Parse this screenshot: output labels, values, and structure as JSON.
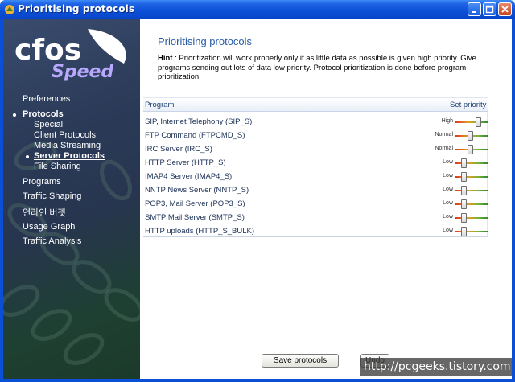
{
  "window": {
    "title": "Prioritising protocols"
  },
  "sidebar": {
    "logo_text": "cfos",
    "logo_subtext": "Speed",
    "items": [
      {
        "label": "Preferences",
        "level": 0,
        "bullet": false,
        "bold": false
      },
      {
        "label": "Protocols",
        "level": 0,
        "bullet": true,
        "bold": true
      },
      {
        "label": "Special",
        "level": 1,
        "bullet": false,
        "bold": false
      },
      {
        "label": "Client Protocols",
        "level": 1,
        "bullet": false,
        "bold": false
      },
      {
        "label": "Media Streaming",
        "level": 1,
        "bullet": false,
        "bold": false
      },
      {
        "label": "Server Protocols",
        "level": 1,
        "bullet": true,
        "bold": true,
        "active": true
      },
      {
        "label": "File Sharing",
        "level": 1,
        "bullet": false,
        "bold": false
      },
      {
        "label": "Programs",
        "level": 0,
        "bullet": false,
        "bold": false
      },
      {
        "label": "Traffic Shaping",
        "level": 0,
        "bullet": false,
        "bold": false
      },
      {
        "label": "언라인 버젯",
        "level": 0,
        "bullet": false,
        "bold": false
      },
      {
        "label": "Usage Graph",
        "level": 0,
        "bullet": false,
        "bold": false
      },
      {
        "label": "Traffic Analysis",
        "level": 0,
        "bullet": false,
        "bold": false
      }
    ]
  },
  "main": {
    "title": "Prioritising protocols",
    "hint_label": "Hint",
    "hint_text": " : Prioritization will work properly only if as little data as possible is given high priority. Give programs sending out lots of data low priority. Protocol prioritization is done before program prioritization.",
    "columns": {
      "program": "Program",
      "priority": "Set priority"
    },
    "rows": [
      {
        "name": "SIP, Internet Telephony (SIP_S)",
        "level": "High",
        "position": 0.75
      },
      {
        "name": "FTP Command (FTPCMD_S)",
        "level": "Normal",
        "position": 0.45
      },
      {
        "name": "IRC Server (IRC_S)",
        "level": "Normal",
        "position": 0.45
      },
      {
        "name": "HTTP Server (HTTP_S)",
        "level": "Low",
        "position": 0.2
      },
      {
        "name": "IMAP4 Server (IMAP4_S)",
        "level": "Low",
        "position": 0.2
      },
      {
        "name": "NNTP News Server (NNTP_S)",
        "level": "Low",
        "position": 0.2
      },
      {
        "name": "POP3, Mail Server (POP3_S)",
        "level": "Low",
        "position": 0.2
      },
      {
        "name": "SMTP Mail Server (SMTP_S)",
        "level": "Low",
        "position": 0.2
      },
      {
        "name": "HTTP uploads (HTTP_S_BULK)",
        "level": "Low",
        "position": 0.2
      }
    ],
    "save_button": "Save protocols",
    "undo_button": "Undo"
  },
  "watermark": "http://pcgeeks.tistory.com"
}
